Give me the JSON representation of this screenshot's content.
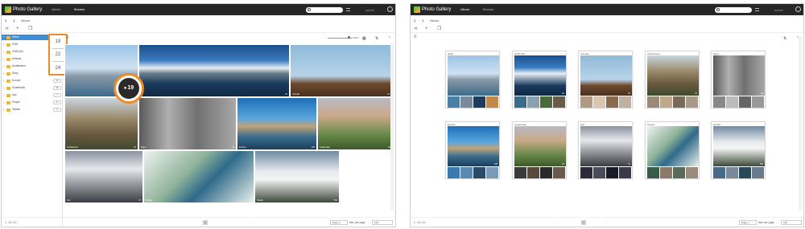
{
  "app": {
    "title": "Photo Gallery"
  },
  "left": {
    "nav": {
      "album": "Album",
      "browse": "Browse"
    },
    "admin": "admin",
    "breadcrumb": "Album",
    "sidebar": [
      {
        "label": "Album",
        "count": ""
      },
      {
        "label": "2018",
        "count": "19"
      },
      {
        "label": "2018 (All)",
        "count": "22"
      },
      {
        "label": "Animals",
        "count": "24"
      },
      {
        "label": "Architecture",
        "count": "15"
      },
      {
        "label": "Diary",
        "count": "22"
      },
      {
        "label": "Europe",
        "count": "24"
      },
      {
        "label": "Guatemala",
        "count": "26"
      },
      {
        "label": "Iran",
        "count": "7"
      },
      {
        "label": "People",
        "count": "8"
      },
      {
        "label": "Taiwan",
        "count": "9"
      }
    ],
    "highlight_counts": [
      "19",
      "22",
      "24"
    ],
    "circle_count": "19",
    "zoom_text": "100%",
    "tiles": [
      {
        "label": "",
        "count": ""
      },
      {
        "label": "",
        "count": "22"
      },
      {
        "label": "Animals",
        "count": "24"
      },
      {
        "label": "Architecture",
        "count": "15"
      },
      {
        "label": "Diary",
        "count": "22"
      },
      {
        "label": "Europe",
        "count": "105"
      },
      {
        "label": "Guatemala",
        "count": "26"
      },
      {
        "label": "Iran",
        "count": "47"
      },
      {
        "label": "People",
        "count": "8"
      },
      {
        "label": "Taiwan",
        "count": "750"
      }
    ],
    "footer": {
      "range": "1 - 10 / 10",
      "page_btn": "1",
      "page_select": "Page 1",
      "per_page_label": "Item per page",
      "per_page": "100"
    }
  },
  "right": {
    "nav": {
      "album": "Album",
      "browse": "Browse"
    },
    "admin": "admin",
    "breadcrumb": "Album",
    "albums": [
      {
        "name": "2018",
        "count": ""
      },
      {
        "name": "2018 (All)",
        "count": "22"
      },
      {
        "name": "Animals",
        "count": "24"
      },
      {
        "name": "Architecture",
        "count": "15"
      },
      {
        "name": "Diary",
        "count": "22"
      },
      {
        "name": "Europe",
        "count": "105"
      },
      {
        "name": "Guatemala",
        "count": "26"
      },
      {
        "name": "Iran",
        "count": "47"
      },
      {
        "name": "People",
        "count": "8"
      },
      {
        "name": "Taiwan",
        "count": "750"
      }
    ],
    "footer": {
      "range": "1 - 10 / 10",
      "page_btn": "1",
      "page_select": "Page 1",
      "per_page_label": "Item per page",
      "per_page": "100"
    }
  },
  "colors": {
    "topbar": "#262626",
    "accent": "#f08a24",
    "selected": "#3e8fd6"
  }
}
